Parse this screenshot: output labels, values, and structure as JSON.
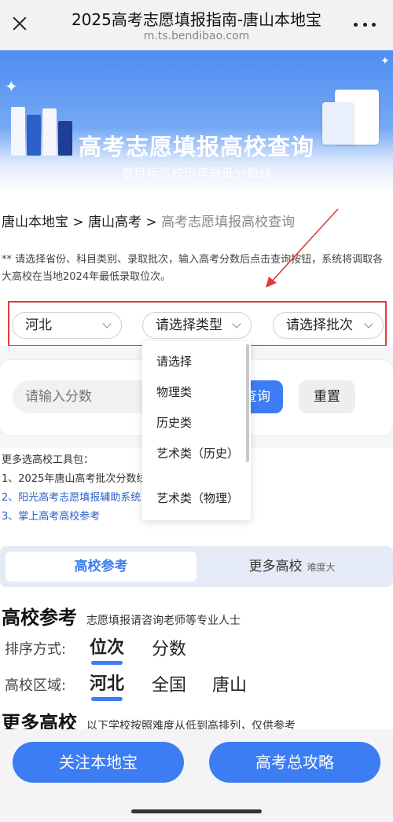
{
  "nav": {
    "title": "2025高考志愿填报指南-唐山本地宝",
    "url": "m.ts.bendibao.com"
  },
  "banner": {
    "title": "高考志愿填报高校查询",
    "subtitle": "查目标院校历年最低分数线"
  },
  "breadcrumb": {
    "item1": "唐山本地宝",
    "sep1": " > ",
    "item2": "唐山高考",
    "sep2": " > ",
    "current": "高考志愿填报高校查询"
  },
  "note": "** 请选择省份、科目类别、录取批次，输入高考分数后点击查询按钮，系统将调取各大高校在当地2024年最低录取位次。",
  "selectors": {
    "province": "河北",
    "type": "请选择类型",
    "batch": "请选择批次"
  },
  "dropdown": {
    "items": [
      "请选择",
      "物理类",
      "历史类",
      "艺术类（历史）",
      "艺术类（物理）"
    ]
  },
  "score": {
    "placeholder": "请输入分数",
    "query_label": "查询",
    "reset_label": "重置"
  },
  "tools": {
    "heading": "更多选高校工具包：",
    "items": [
      "1、2025年唐山高考批次分数线",
      "2、阳光高考志愿填报辅助系统",
      "3、掌上高考高校参考"
    ]
  },
  "tabs": {
    "active": "高校参考",
    "other": "更多高校",
    "other_hint": "难度大"
  },
  "section1": {
    "title": "高校参考",
    "desc": "志愿填报请咨询老师等专业人士"
  },
  "sort": {
    "label": "排序方式:",
    "options": [
      "位次",
      "分数"
    ]
  },
  "region": {
    "label": "高校区域:",
    "options": [
      "河北",
      "全国",
      "唐山"
    ]
  },
  "section2": {
    "title": "更多高校",
    "desc": "以下学校按照难度从低到高排列，仅供参考"
  },
  "bottom": {
    "follow_label": "关注本地宝",
    "guide_label": "高考总攻略"
  },
  "colors": {
    "accent": "#3d7df3",
    "highlight_border": "#e23a3a",
    "link": "#2a5fc4"
  }
}
